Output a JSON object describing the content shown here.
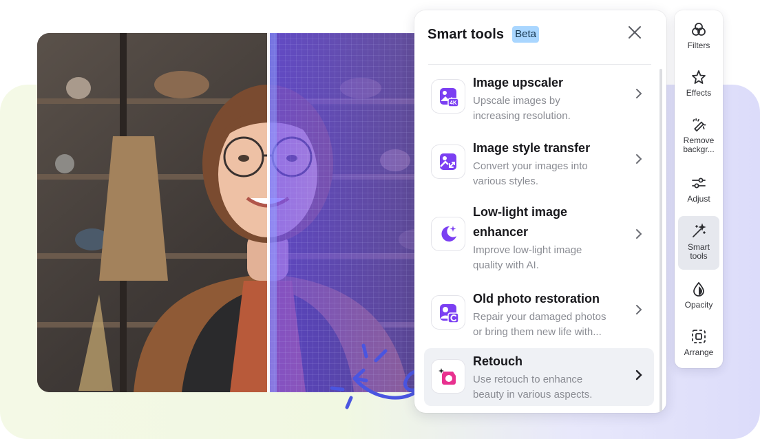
{
  "panel": {
    "title": "Smart tools",
    "badge": "Beta",
    "close_icon": "close-icon",
    "tools": [
      {
        "title": "Image upscaler",
        "desc_line1": "Upscale images by",
        "desc_line2": "increasing resolution.",
        "icon": "image-4k-icon"
      },
      {
        "title": "Image style transfer",
        "desc_line1": "Convert your images into",
        "desc_line2": "various styles.",
        "icon": "image-style-icon"
      },
      {
        "title_line1": "Low-light image",
        "title_line2": "enhancer",
        "desc_line1": "Improve low-light image",
        "desc_line2": "quality with AI.",
        "icon": "moon-sparkle-icon"
      },
      {
        "title": "Old photo restoration",
        "desc_line1": "Repair your damaged photos",
        "desc_line2": "or bring them new life with...",
        "icon": "photo-restore-icon"
      },
      {
        "title": "Retouch",
        "desc_line1": "Use retouch to enhance",
        "desc_line2": "beauty in various aspects.",
        "icon": "retouch-icon",
        "active": true
      }
    ]
  },
  "rail": {
    "items": [
      {
        "label": "Filters",
        "icon": "filters-icon"
      },
      {
        "label": "Effects",
        "icon": "effects-star-icon"
      },
      {
        "label_line1": "Remove",
        "label_line2": "backgr...",
        "icon": "remove-background-icon"
      },
      {
        "label": "Adjust",
        "icon": "adjust-sliders-icon"
      },
      {
        "label_line1": "Smart",
        "label_line2": "tools",
        "icon": "magic-wand-icon",
        "active": true
      },
      {
        "label": "Opacity",
        "icon": "opacity-drop-icon"
      },
      {
        "label": "Arrange",
        "icon": "arrange-icon"
      }
    ]
  },
  "colors": {
    "accent_purple": "#7b3ff2",
    "accent_pink": "#e8318f",
    "beta_badge_bg": "#a9d6ff",
    "sparkle_blue": "#4a55e0"
  }
}
